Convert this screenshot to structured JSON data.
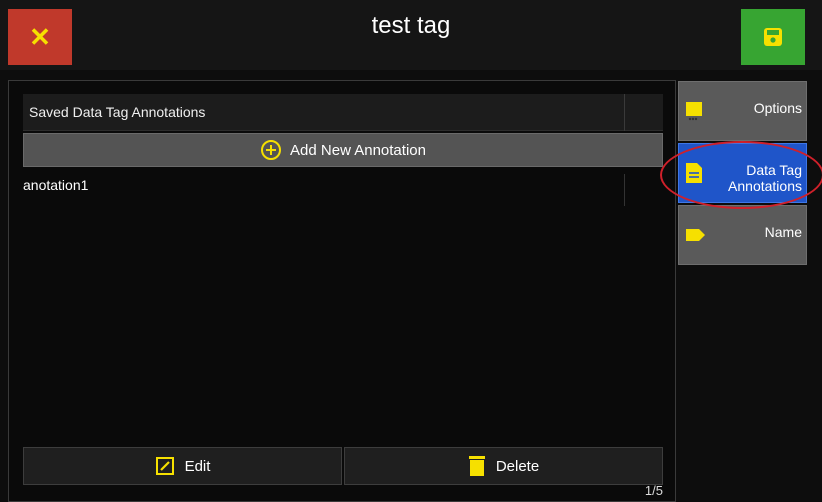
{
  "header": {
    "title": "test tag",
    "close_label": "✕",
    "close_color": "#c0392b",
    "save_color": "#37a532"
  },
  "panel": {
    "list_title": "Saved Data Tag Annotations",
    "add_label": "Add New Annotation",
    "items": [
      {
        "label": "anotation1"
      }
    ],
    "edit_label": "Edit",
    "delete_label": "Delete",
    "page_indicator": "1/5"
  },
  "sidebar": {
    "tabs": [
      {
        "label": "Options",
        "icon": "comment-icon",
        "active": false
      },
      {
        "label": "Data Tag Annotations",
        "icon": "document-icon",
        "active": true
      },
      {
        "label": "Name",
        "icon": "tag-icon",
        "active": false
      }
    ]
  },
  "colors": {
    "accent_yellow": "#f6e000",
    "active_tab": "#1f55c9",
    "highlight_ring": "#d0202a"
  }
}
